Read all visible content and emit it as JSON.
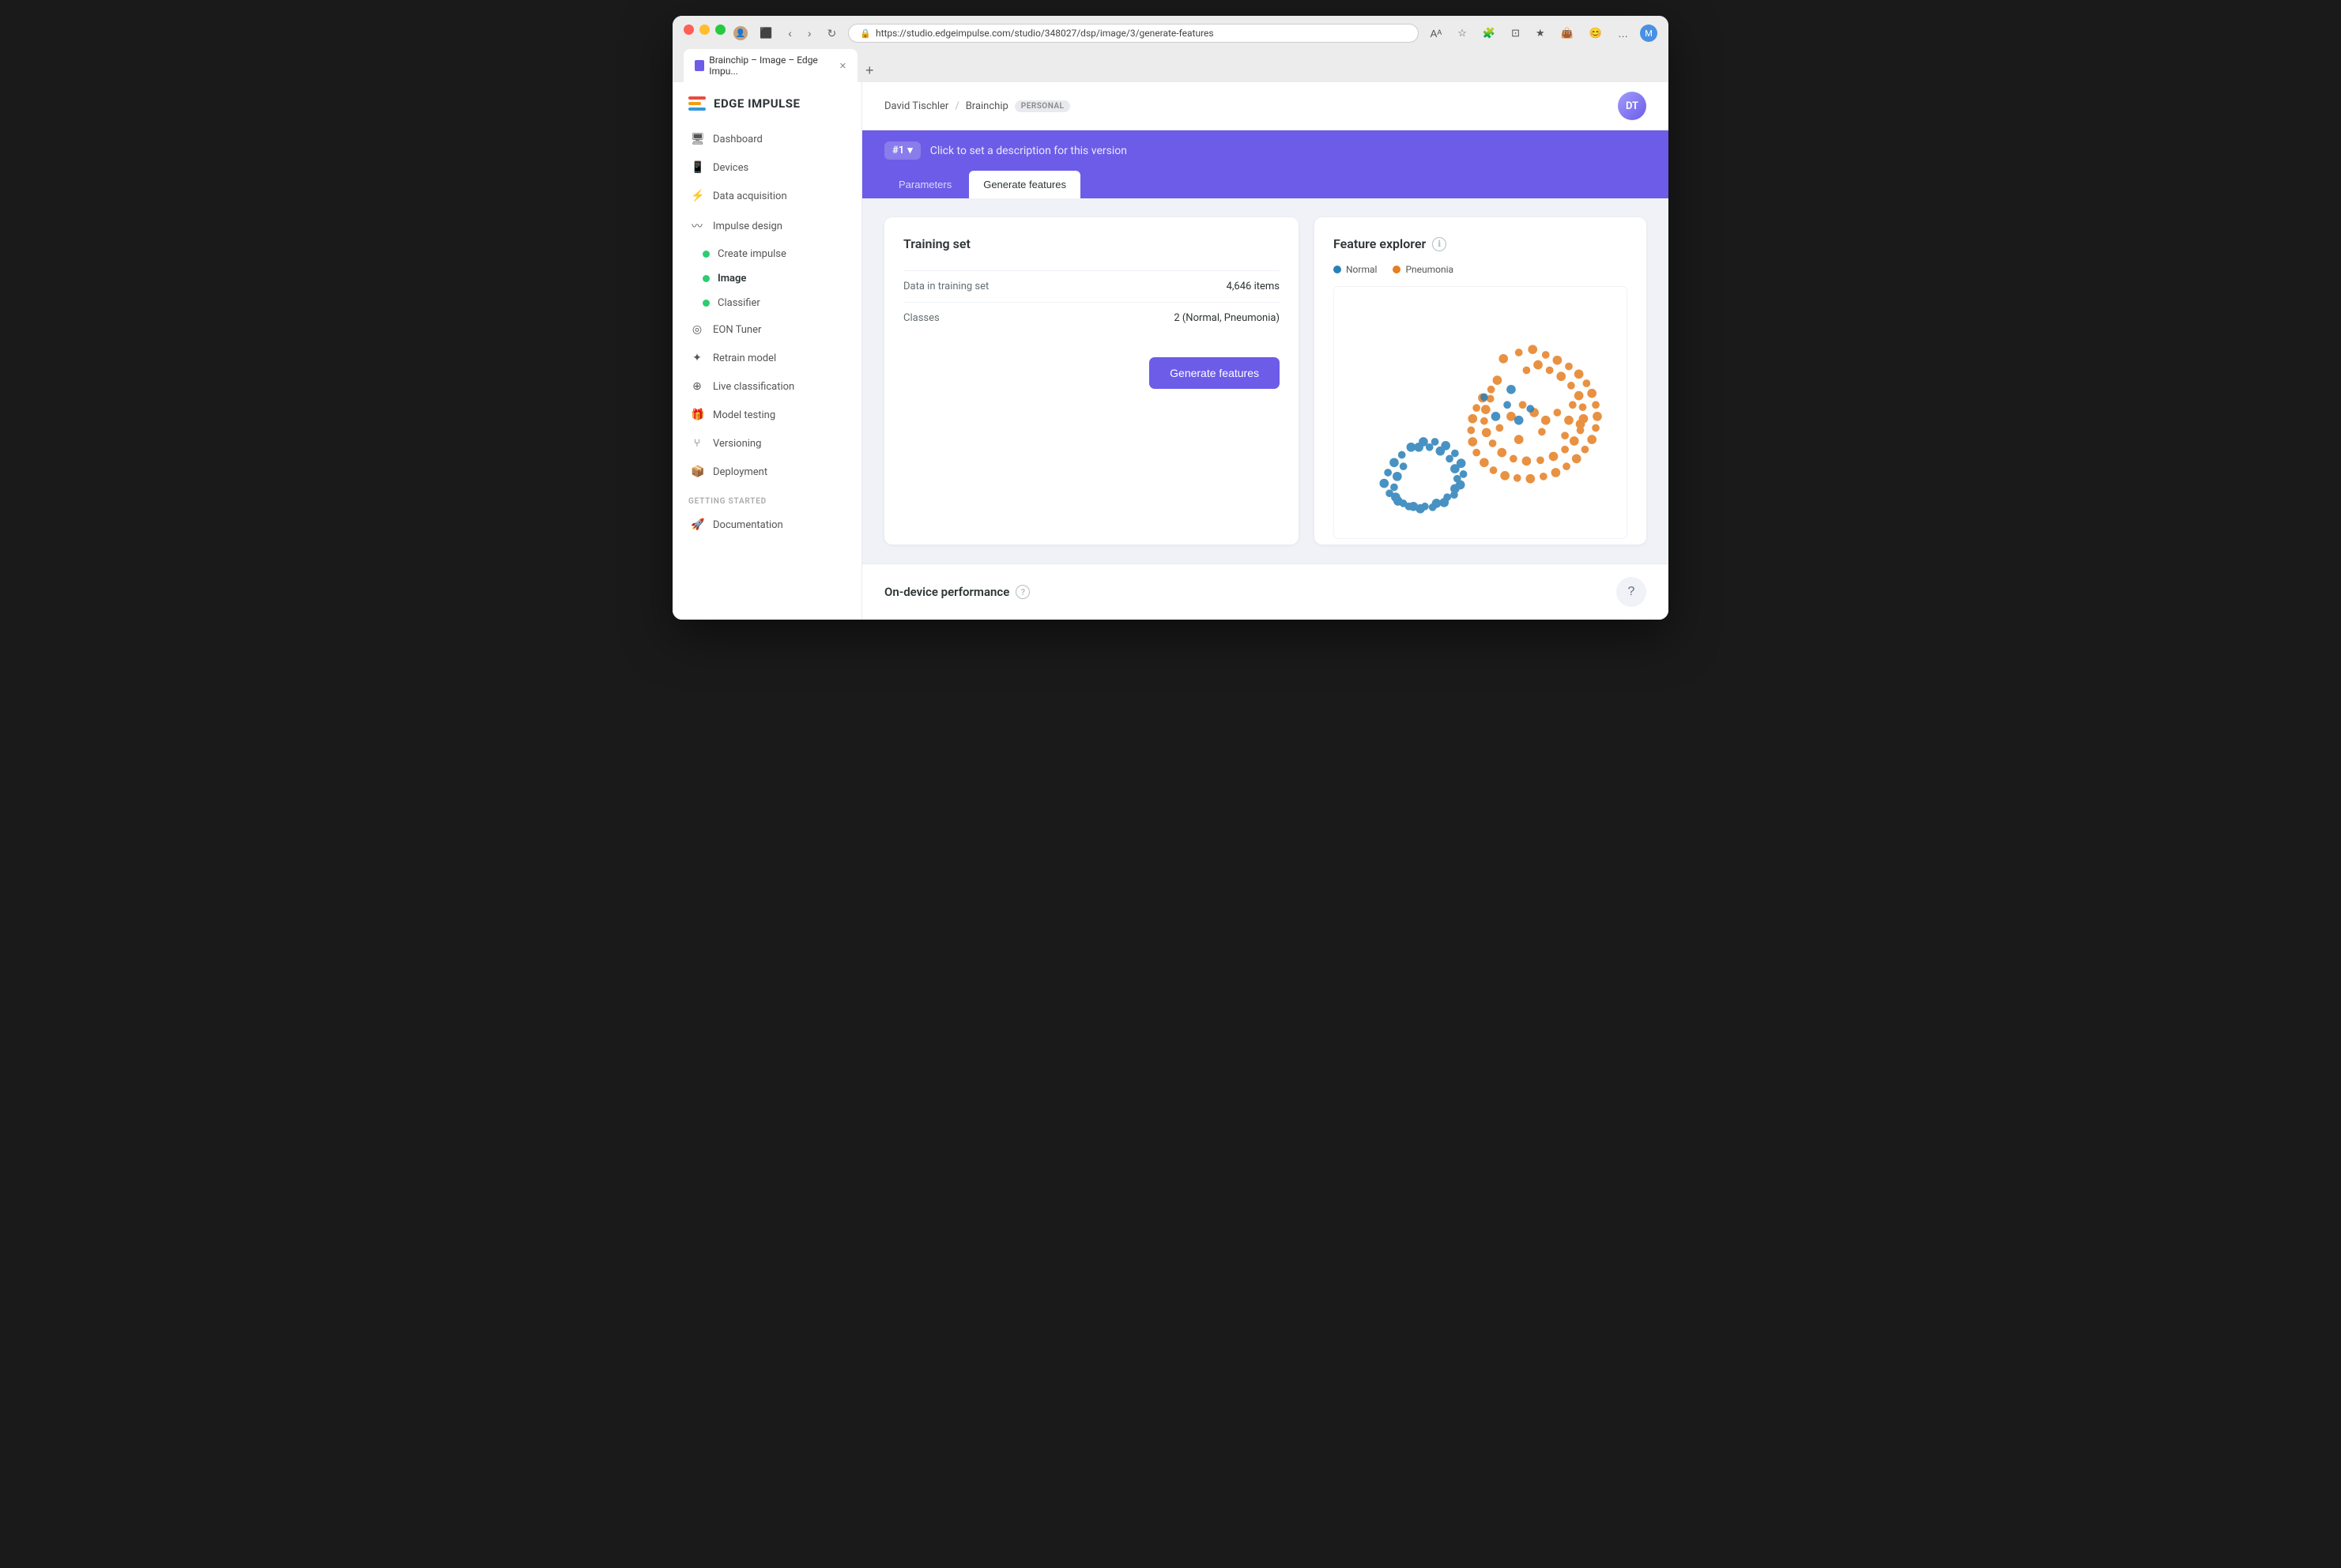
{
  "browser": {
    "url": "https://studio.edgeimpulse.com/studio/348027/dsp/image/3/generate-features",
    "tab_title": "Brainchip – Image – Edge Impu...",
    "tab_favicon": "EI"
  },
  "header": {
    "user": "David Tischler",
    "project": "Brainchip",
    "personal_label": "PERSONAL"
  },
  "logo": {
    "text": "EDGE IMPULSE"
  },
  "sidebar": {
    "items": [
      {
        "id": "dashboard",
        "label": "Dashboard",
        "icon": "🖥"
      },
      {
        "id": "devices",
        "label": "Devices",
        "icon": "📱"
      },
      {
        "id": "data-acquisition",
        "label": "Data acquisition",
        "icon": "⚡"
      },
      {
        "id": "impulse-design",
        "label": "Impulse design",
        "icon": "〰"
      }
    ],
    "sub_items": [
      {
        "id": "create-impulse",
        "label": "Create impulse"
      },
      {
        "id": "image",
        "label": "Image",
        "active": true
      },
      {
        "id": "classifier",
        "label": "Classifier"
      }
    ],
    "more_items": [
      {
        "id": "eon-tuner",
        "label": "EON Tuner",
        "icon": "◎"
      },
      {
        "id": "retrain-model",
        "label": "Retrain model",
        "icon": "✦"
      },
      {
        "id": "live-classification",
        "label": "Live classification",
        "icon": "⊕"
      },
      {
        "id": "model-testing",
        "label": "Model testing",
        "icon": "🎁"
      },
      {
        "id": "versioning",
        "label": "Versioning",
        "icon": "⑂"
      },
      {
        "id": "deployment",
        "label": "Deployment",
        "icon": "📦"
      }
    ],
    "getting_started_label": "GETTING STARTED",
    "docs_items": [
      {
        "id": "documentation",
        "label": "Documentation",
        "icon": "🚀"
      }
    ]
  },
  "version_banner": {
    "version_label": "#1",
    "dropdown_arrow": "▾",
    "description": "Click to set a description for this version"
  },
  "tabs": [
    {
      "id": "parameters",
      "label": "Parameters",
      "active": false
    },
    {
      "id": "generate-features",
      "label": "Generate features",
      "active": true
    }
  ],
  "training_card": {
    "title": "Training set",
    "rows": [
      {
        "label": "Data in training set",
        "value": "4,646 items"
      },
      {
        "label": "Classes",
        "value": "2 (Normal, Pneumonia)"
      }
    ],
    "generate_button": "Generate features"
  },
  "feature_explorer": {
    "title": "Feature explorer",
    "legend": [
      {
        "color": "#2980b9",
        "label": "Normal"
      },
      {
        "color": "#e67e22",
        "label": "Pneumonia"
      }
    ]
  },
  "on_device": {
    "title": "On-device performance"
  }
}
